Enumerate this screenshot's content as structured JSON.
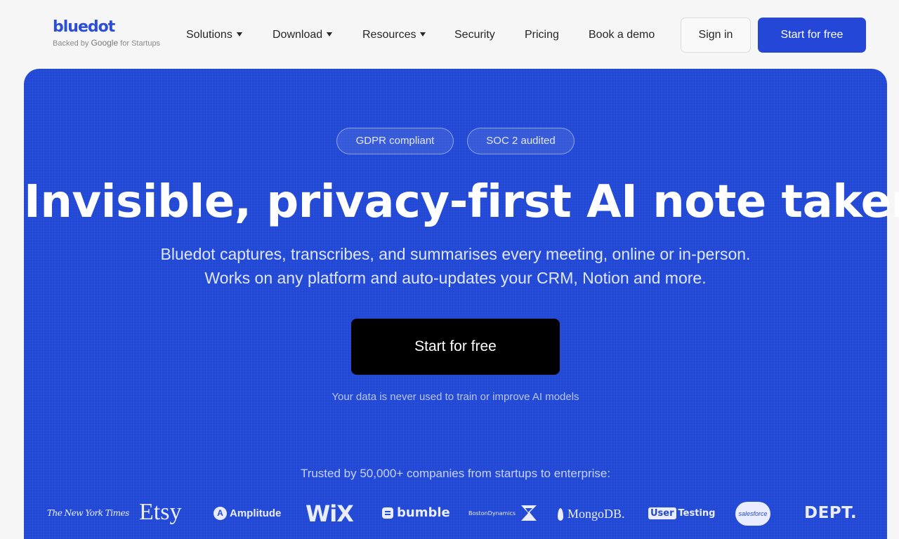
{
  "brand": {
    "name": "bluedot",
    "tagline_prefix": "Backed by",
    "tagline_google": "Google",
    "tagline_suffix": "for Startups"
  },
  "nav": {
    "items": [
      {
        "label": "Solutions",
        "has_dropdown": true
      },
      {
        "label": "Download",
        "has_dropdown": true
      },
      {
        "label": "Resources",
        "has_dropdown": true
      },
      {
        "label": "Security",
        "has_dropdown": false
      },
      {
        "label": "Pricing",
        "has_dropdown": false
      },
      {
        "label": "Book a demo",
        "has_dropdown": false
      }
    ],
    "sign_in": "Sign in",
    "start_free": "Start for free"
  },
  "hero": {
    "badges": [
      "GDPR compliant",
      "SOC 2 audited"
    ],
    "headline": "Invisible, privacy-first AI note taker",
    "subline_1": "Bluedot captures, transcribes, and summarises every meeting, online or in-person.",
    "subline_2": "Works on any platform and auto-updates your CRM, Notion and more.",
    "cta": "Start for free",
    "disclaimer": "Your data is never used to train or improve AI models",
    "trusted": "Trusted by 50,000+ companies from startups to enterprise:"
  },
  "logos": {
    "nyt": "The New York Times",
    "etsy": "Etsy",
    "amplitude": "Amplitude",
    "wix": "WiX",
    "bumble": "bumble",
    "boston_dynamics": "BostonDynamics",
    "mongodb": "MongoDB.",
    "usertesting_box": "User",
    "usertesting_text": "Testing",
    "salesforce": "salesforce",
    "dept": "DEPT."
  },
  "colors": {
    "accent": "#2447d8",
    "hero_bg": "#2249d6",
    "cta_bg": "#000000"
  }
}
